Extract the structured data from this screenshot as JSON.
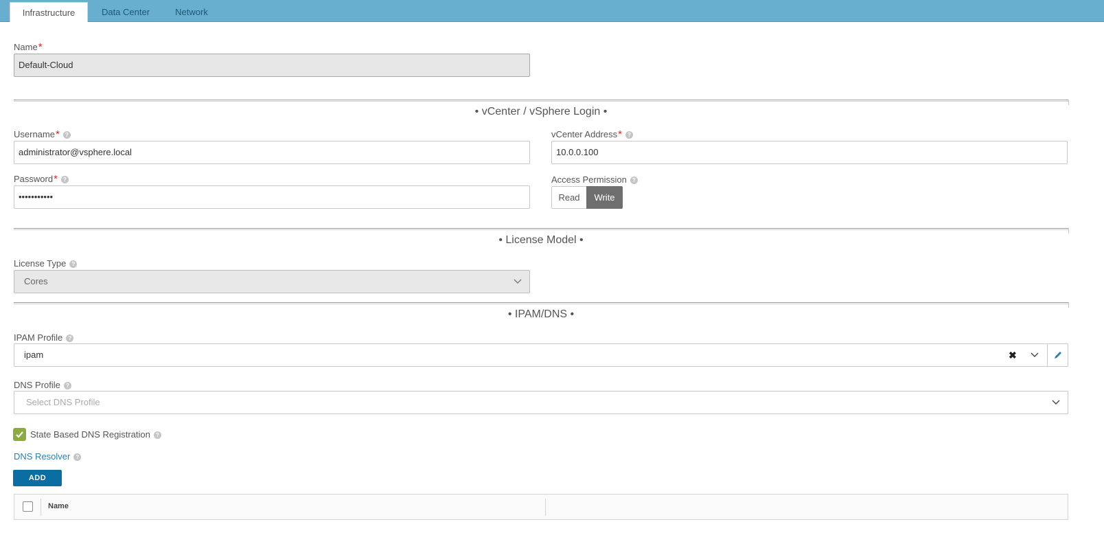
{
  "tabs": [
    {
      "label": "Infrastructure",
      "active": true
    },
    {
      "label": "Data Center",
      "active": false
    },
    {
      "label": "Network",
      "active": false
    }
  ],
  "name": {
    "label": "Name",
    "required_mark": "*",
    "value": "Default-Cloud"
  },
  "sections": {
    "login": "• vCenter / vSphere Login •",
    "license": "• License Model •",
    "ipam": "• IPAM/DNS •"
  },
  "username": {
    "label": "Username",
    "required_mark": "*",
    "value": "administrator@vsphere.local"
  },
  "vcenter_address": {
    "label": "vCenter Address",
    "required_mark": "*",
    "value": "10.0.0.100"
  },
  "password": {
    "label": "Password",
    "required_mark": "*",
    "value": "•••••••••••"
  },
  "access_permission": {
    "label": "Access Permission",
    "options": [
      "Read",
      "Write"
    ],
    "selected": "Write"
  },
  "license_type": {
    "label": "License Type",
    "value": "Cores"
  },
  "ipam_profile": {
    "label": "IPAM Profile",
    "value": "ipam"
  },
  "dns_profile": {
    "label": "DNS Profile",
    "placeholder": "Select DNS Profile"
  },
  "state_based_dns": {
    "label": "State Based DNS Registration",
    "checked": true
  },
  "dns_resolver": {
    "label": "DNS Resolver",
    "add_label": "ADD",
    "columns": [
      "Name"
    ]
  },
  "help_glyph": "?",
  "colors": {
    "tab_bar": "#67aecf",
    "button": "#0a6ea3",
    "checkbox": "#8bab3f",
    "link": "#2a7fb0",
    "required": "#e0202a",
    "write_selected": "#6e6e6e"
  }
}
